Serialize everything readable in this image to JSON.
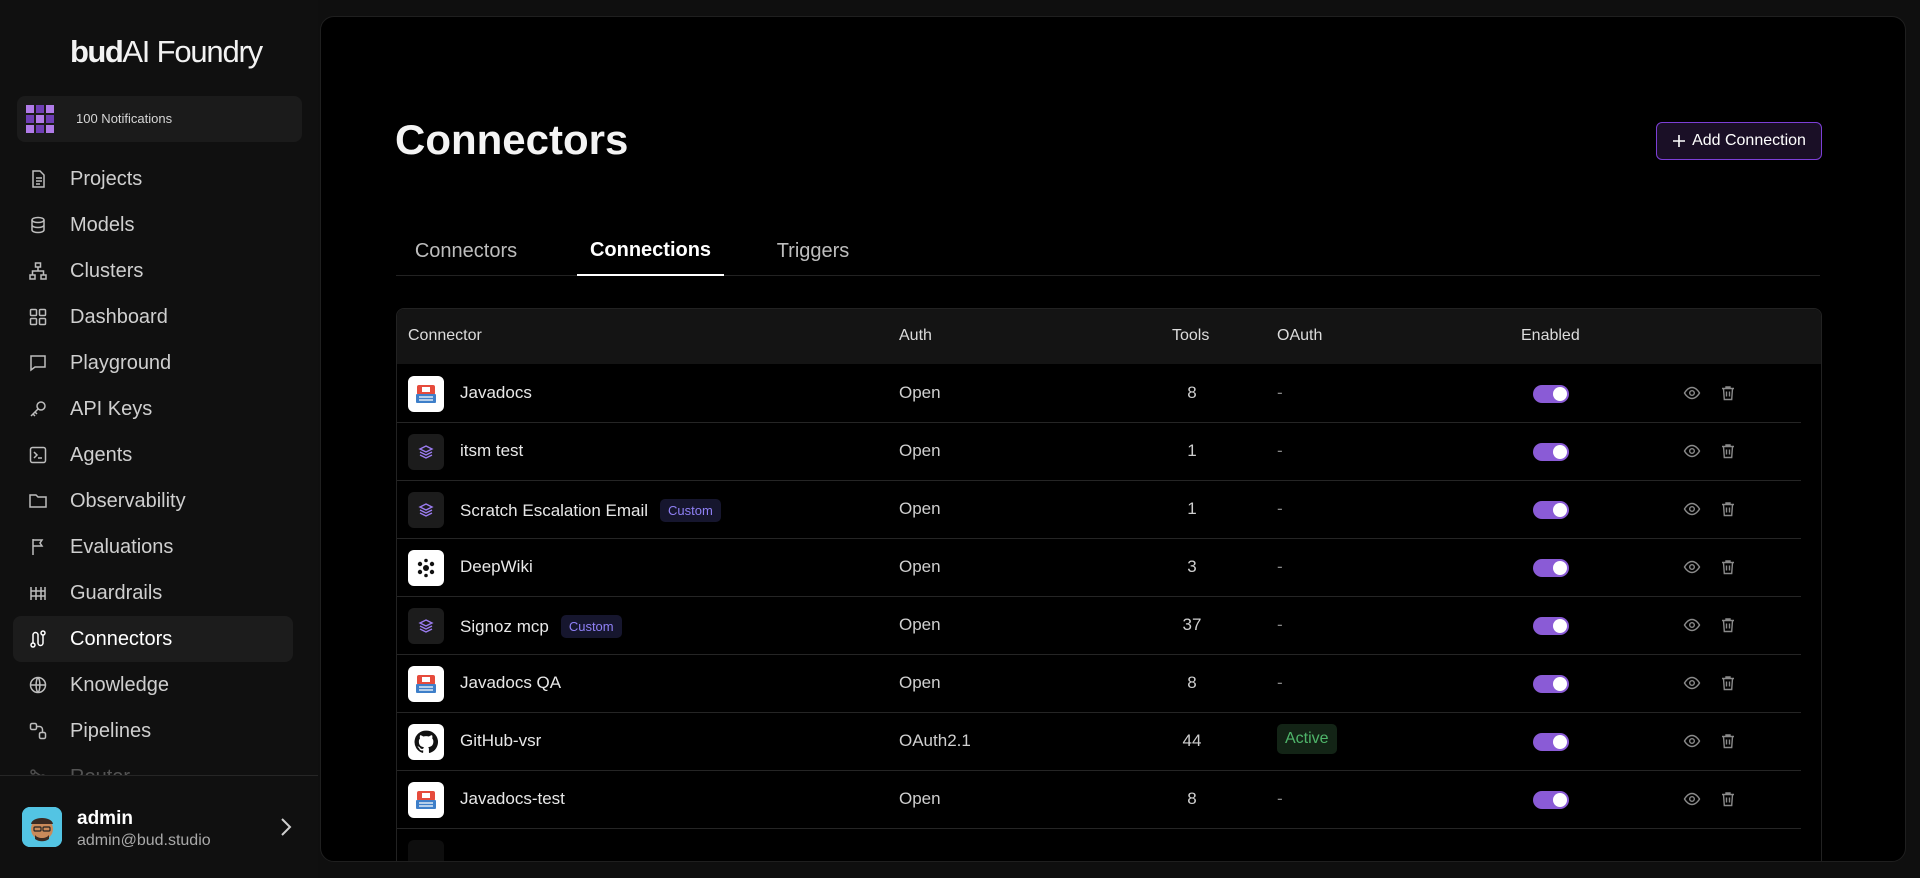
{
  "brand": {
    "logo_bold": "bud",
    "logo_rest": "AI Foundry"
  },
  "notifications": {
    "label": "100 Notifications"
  },
  "sidebar": {
    "items": [
      {
        "label": "Projects",
        "icon": "file-icon"
      },
      {
        "label": "Models",
        "icon": "database-icon"
      },
      {
        "label": "Clusters",
        "icon": "network-icon"
      },
      {
        "label": "Dashboard",
        "icon": "grid-icon"
      },
      {
        "label": "Playground",
        "icon": "chat-icon"
      },
      {
        "label": "API Keys",
        "icon": "key-icon"
      },
      {
        "label": "Agents",
        "icon": "terminal-icon"
      },
      {
        "label": "Observability",
        "icon": "folder-icon"
      },
      {
        "label": "Evaluations",
        "icon": "flag-icon"
      },
      {
        "label": "Guardrails",
        "icon": "fence-icon"
      },
      {
        "label": "Connectors",
        "icon": "route-icon",
        "active": true
      },
      {
        "label": "Knowledge",
        "icon": "globe-icon"
      },
      {
        "label": "Pipelines",
        "icon": "pipeline-icon"
      },
      {
        "label": "Router",
        "icon": "router-icon"
      }
    ]
  },
  "user": {
    "name": "admin",
    "email": "admin@bud.studio"
  },
  "page": {
    "title": "Connectors",
    "add_button": "Add Connection"
  },
  "tabs": [
    {
      "label": "Connectors"
    },
    {
      "label": "Connections",
      "active": true
    },
    {
      "label": "Triggers"
    }
  ],
  "table": {
    "headers": {
      "connector": "Connector",
      "auth": "Auth",
      "tools": "Tools",
      "oauth": "OAuth",
      "enabled": "Enabled"
    },
    "rows": [
      {
        "name": "Javadocs",
        "icon": "javadocs-icon",
        "badge": "",
        "auth": "Open",
        "tools": "8",
        "oauth": "-",
        "enabled": true
      },
      {
        "name": "itsm test",
        "icon": "layers-icon",
        "badge": "",
        "auth": "Open",
        "tools": "1",
        "oauth": "-",
        "enabled": true
      },
      {
        "name": "Scratch Escalation Email",
        "icon": "layers-icon",
        "badge": "Custom",
        "auth": "Open",
        "tools": "1",
        "oauth": "-",
        "enabled": true
      },
      {
        "name": "DeepWiki",
        "icon": "deepwiki-icon",
        "badge": "",
        "auth": "Open",
        "tools": "3",
        "oauth": "-",
        "enabled": true
      },
      {
        "name": "Signoz mcp",
        "icon": "layers-icon",
        "badge": "Custom",
        "auth": "Open",
        "tools": "37",
        "oauth": "-",
        "enabled": true
      },
      {
        "name": "Javadocs QA",
        "icon": "javadocs-icon",
        "badge": "",
        "auth": "Open",
        "tools": "8",
        "oauth": "-",
        "enabled": true
      },
      {
        "name": "GitHub-vsr",
        "icon": "github-icon",
        "badge": "",
        "auth": "OAuth2.1",
        "tools": "44",
        "oauth": "Active",
        "enabled": true
      },
      {
        "name": "Javadocs-test",
        "icon": "javadocs-icon",
        "badge": "",
        "auth": "Open",
        "tools": "8",
        "oauth": "-",
        "enabled": true
      }
    ]
  },
  "colors": {
    "accent": "#8a5bd6",
    "active_status": "#4fb56a",
    "custom_badge": "#8f80f5"
  }
}
